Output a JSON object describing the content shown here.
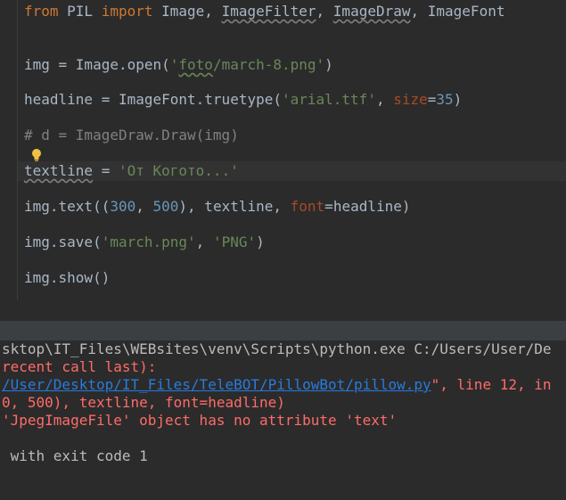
{
  "editor": {
    "line1": {
      "kw1": "from",
      "mod": " PIL ",
      "kw2": "import",
      "rest_a": " Image, ",
      "imgfilter": "ImageFilter",
      "comma1": ", ",
      "imgdraw": "ImageDraw",
      "rest_b": ", ImageFont"
    },
    "line2": {
      "pre": "img = Image.open(",
      "q1": "'",
      "path": "foto",
      "path2": "/march-8.png",
      "q2": "'",
      "post": ")"
    },
    "line3": {
      "pre": "headline = ImageFont.truetype(",
      "str": "'arial.ttf'",
      "mid": ", ",
      "param": "size",
      "eq": "=",
      "num": "35",
      "post": ")"
    },
    "line4": {
      "comment": "# d = ImageDraw.Draw(img)"
    },
    "line5": {
      "var": "textline",
      "mid": " = ",
      "str": "'От Когото...'"
    },
    "line6": {
      "pre": "img.text((",
      "num1": "300",
      "comma": ", ",
      "num2": "500",
      "mid": "), textline, ",
      "param": "font",
      "eq": "=",
      "post": "headline)"
    },
    "line7": {
      "pre": "img.save(",
      "str1": "'march.png'",
      "comma": ", ",
      "str2": "'PNG'",
      "post": ")"
    },
    "line8": {
      "text": "img.show()"
    }
  },
  "console": {
    "line1": "sktop\\IT_Files\\WEBsites\\venv\\Scripts\\python.exe C:/Users/User/De",
    "line2": "recent call last):",
    "line3_link": "/User/Desktop/IT_Files/TeleBOT/PillowBot/pillow.py",
    "line3_rest": "\", line 12, in",
    "line4": "0, 500), textline, font=headline)",
    "line5": "'JpegImageFile' object has no attribute 'text'",
    "line6": " with exit code 1"
  },
  "icons": {
    "bulb": "lightbulb-icon"
  },
  "colors": {
    "background": "#2b2b2b",
    "keyword": "#cc7832",
    "string": "#6a8759",
    "number": "#6897bb",
    "error": "#ff6b68",
    "link": "#287bde"
  }
}
